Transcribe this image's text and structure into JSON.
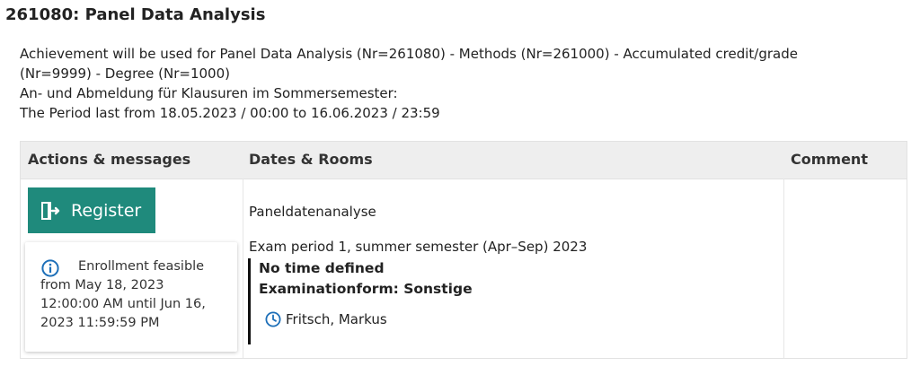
{
  "page": {
    "title": "261080: Panel Data Analysis"
  },
  "description": {
    "line1": "Achievement will be used for Panel Data Analysis (Nr=261080) - Methods (Nr=261000) - Accumulated credit/grade",
    "line2": "(Nr=9999) - Degree (Nr=1000)",
    "line3": "An- und Abmeldung für Klausuren im Sommersemester:",
    "line4": "The Period last from 18.05.2023 / 00:00 to 16.06.2023 / 23:59"
  },
  "table": {
    "headers": {
      "actions": "Actions & messages",
      "dates": "Dates & Rooms",
      "comment": "Comment"
    },
    "actions": {
      "register_label": "Register",
      "info_text": "Enrollment feasible from May 18, 2023 12:00:00 AM until Jun 16, 2023 11:59:59 PM"
    },
    "dates": {
      "event_title": "Paneldatenanalyse",
      "exam_period": "Exam period 1, summer semester (Apr–Sep) 2023",
      "time_line": "No time defined",
      "exam_form": "Examinationform: Sonstige",
      "lecturer": "Fritsch, Markus"
    },
    "comment": ""
  },
  "colors": {
    "accent": "#1f8a7c",
    "info_blue": "#1d6fb8",
    "header_bg": "#eeeeee"
  },
  "icons": {
    "register": "door-enter-icon",
    "info": "info-circle-icon",
    "lecturer": "clock-icon"
  }
}
